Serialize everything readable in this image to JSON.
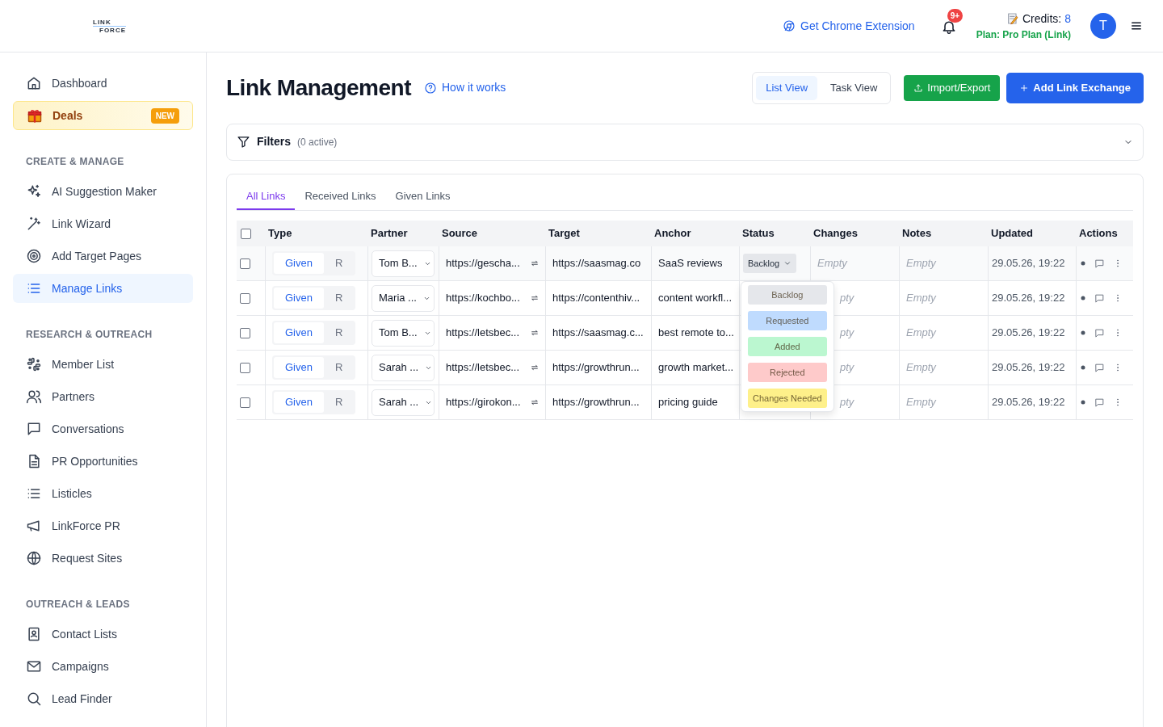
{
  "header": {
    "logo": [
      "LINK",
      "FORCE"
    ],
    "extension_link": "Get Chrome Extension",
    "notifications_badge": "9+",
    "credits_label": "Credits:",
    "credits_value": "8",
    "plan": "Plan: Pro Plan (Link)",
    "avatar": "T"
  },
  "sidebar": {
    "sections": [
      {
        "items": [
          {
            "label": "Dashboard",
            "selected": false
          },
          {
            "label": "Deals",
            "selected": false,
            "kind": "deal",
            "badge": "NEW"
          }
        ]
      },
      {
        "heading": "CREATE & MANAGE",
        "items": [
          {
            "label": "AI Suggestion Maker",
            "selected": false
          },
          {
            "label": "Link Wizard",
            "selected": false
          },
          {
            "label": "Add Target Pages",
            "selected": false
          },
          {
            "label": "Manage Links",
            "selected": true
          }
        ]
      },
      {
        "heading": "RESEARCH & OUTREACH",
        "items": [
          {
            "label": "Member List",
            "selected": false
          },
          {
            "label": "Partners",
            "selected": false
          },
          {
            "label": "Conversations",
            "selected": false
          },
          {
            "label": "PR Opportunities",
            "selected": false
          },
          {
            "label": "Listicles",
            "selected": false
          },
          {
            "label": "LinkForce PR",
            "selected": false
          },
          {
            "label": "Request Sites",
            "selected": false
          }
        ]
      },
      {
        "heading": "OUTREACH & LEADS",
        "items": [
          {
            "label": "Contact Lists",
            "selected": false
          },
          {
            "label": "Campaigns",
            "selected": false
          },
          {
            "label": "Lead Finder",
            "selected": false
          }
        ]
      }
    ]
  },
  "page": {
    "title": "Link Management",
    "help_link": "How it works",
    "views": [
      {
        "label": "List View",
        "selected": true
      },
      {
        "label": "Task View",
        "selected": false
      }
    ],
    "import_button": "Import/Export",
    "add_button": "Add Link Exchange",
    "filters": {
      "label": "Filters",
      "count": "(0 active)",
      "expanded": false
    },
    "tabs": [
      {
        "label": "All Links",
        "selected": true
      },
      {
        "label": "Received Links",
        "selected": false
      },
      {
        "label": "Given Links",
        "selected": false
      }
    ]
  },
  "table": {
    "columns": [
      "Type",
      "Partner",
      "Source",
      "Target",
      "Anchor",
      "Status",
      "Changes",
      "Notes",
      "Updated",
      "Actions"
    ],
    "header_checked": false,
    "rows": [
      {
        "checked": false,
        "type": [
          {
            "label": "Given",
            "selected": true
          },
          {
            "label": "R",
            "selected": false
          }
        ],
        "partner": "Tom B...",
        "source": "https://gescha...",
        "target": "https://saasmag.co",
        "anchor": "SaaS reviews",
        "status": "Backlog",
        "changes": "Empty",
        "notes": "Empty",
        "updated": "29.05.26, 19:22"
      },
      {
        "checked": false,
        "type": [
          {
            "label": "Given",
            "selected": true
          },
          {
            "label": "R",
            "selected": false
          }
        ],
        "partner": "Maria ...",
        "source": "https://kochbo...",
        "target": "https://contenthiv...",
        "anchor": "content workfl...",
        "changes": "pty",
        "notes": "Empty",
        "updated": "29.05.26, 19:22"
      },
      {
        "checked": false,
        "type": [
          {
            "label": "Given",
            "selected": true
          },
          {
            "label": "R",
            "selected": false
          }
        ],
        "partner": "Tom B...",
        "source": "https://letsbec...",
        "target": "https://saasmag.c...",
        "anchor": "best remote to...",
        "changes": "pty",
        "notes": "Empty",
        "updated": "29.05.26, 19:22"
      },
      {
        "checked": false,
        "type": [
          {
            "label": "Given",
            "selected": true
          },
          {
            "label": "R",
            "selected": false
          }
        ],
        "partner": "Sarah ...",
        "source": "https://letsbec...",
        "target": "https://growthrun...",
        "anchor": "growth market...",
        "changes": "pty",
        "notes": "Empty",
        "updated": "29.05.26, 19:22"
      },
      {
        "checked": false,
        "type": [
          {
            "label": "Given",
            "selected": true
          },
          {
            "label": "R",
            "selected": false
          }
        ],
        "partner": "Sarah ...",
        "source": "https://girokon...",
        "target": "https://growthrun...",
        "anchor": "pricing guide",
        "changes": "pty",
        "notes": "Empty",
        "updated": "29.05.26, 19:22"
      }
    ],
    "status_menu": {
      "open": true,
      "options": [
        {
          "label": "Backlog",
          "color": "#e5e7eb"
        },
        {
          "label": "Requested",
          "color": "#bfdbfe"
        },
        {
          "label": "Added",
          "color": "#bbf7d0"
        },
        {
          "label": "Rejected",
          "color": "#fecaca"
        },
        {
          "label": "Changes Needed",
          "color": "#fef08a"
        }
      ]
    }
  }
}
